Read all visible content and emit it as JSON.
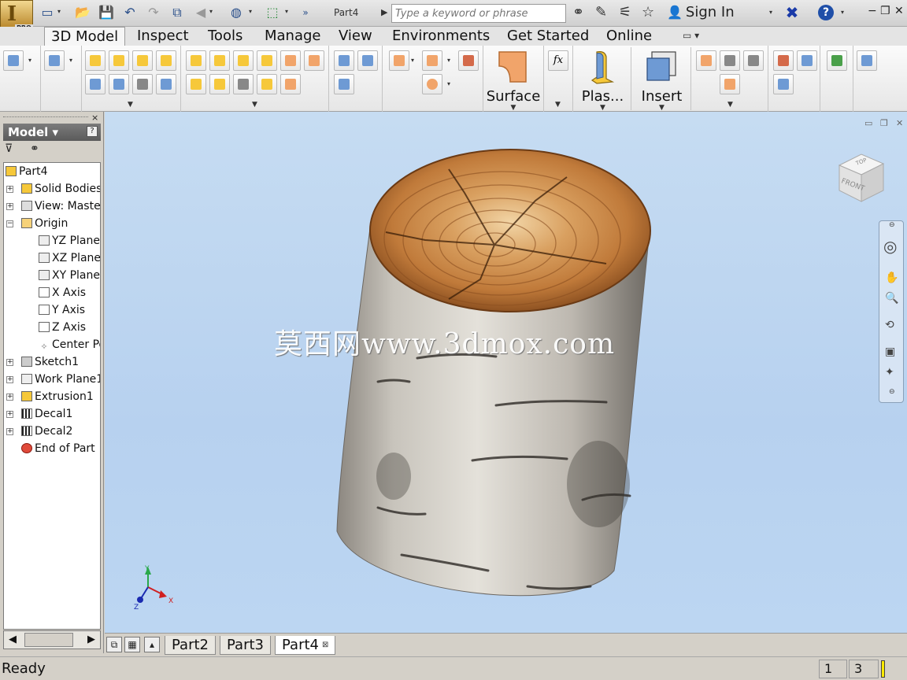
{
  "app": {
    "logo_letter": "I",
    "edition_badge": "PRO",
    "document_title": "Part4",
    "search_placeholder": "Type a keyword or phrase",
    "sign_in_label": "Sign In",
    "help_symbol": "?",
    "window_controls": [
      "−",
      "❐",
      "✕"
    ]
  },
  "quick_access": {
    "icons": [
      "new-icon",
      "open-icon",
      "save-icon",
      "undo-icon",
      "redo-icon",
      "update-icon",
      "back-icon",
      "appearance-icon",
      "select-icon",
      "overflow-icon"
    ]
  },
  "menu_tabs": [
    {
      "label": "3D Model",
      "active": true
    },
    {
      "label": "Inspect",
      "active": false
    },
    {
      "label": "Tools",
      "active": false
    },
    {
      "label": "Manage",
      "active": false
    },
    {
      "label": "View",
      "active": false
    },
    {
      "label": "Environments",
      "active": false
    },
    {
      "label": "Get Started",
      "active": false
    },
    {
      "label": "Online",
      "active": false
    }
  ],
  "ribbon": {
    "big_buttons": [
      {
        "label": "Surface"
      },
      {
        "label": "Plas..."
      },
      {
        "label": "Insert"
      }
    ],
    "fx_label": "fx",
    "accent_colors": {
      "sketch_orange": "#f1a46a",
      "feature_yellow": "#f6c83a",
      "feature_blue": "#6e9ad4"
    }
  },
  "browser": {
    "title": "Model ▾",
    "help_label": "?",
    "filter_icon": "funnel-icon",
    "find_icon": "binoculars-icon",
    "tree": [
      {
        "label": "Part4",
        "icon": "part-icon",
        "expander": ""
      },
      {
        "label": "Solid Bodies(",
        "icon": "solid-bodies-icon",
        "expander": "+"
      },
      {
        "label": "View: Maste",
        "icon": "view-rep-icon",
        "expander": "+"
      },
      {
        "label": "Origin",
        "icon": "folder-icon",
        "expander": "−"
      },
      {
        "label": "YZ Plane",
        "icon": "plane-icon",
        "expander": ""
      },
      {
        "label": "XZ Plane",
        "icon": "plane-icon",
        "expander": ""
      },
      {
        "label": "XY Plane",
        "icon": "plane-icon",
        "expander": ""
      },
      {
        "label": "X Axis",
        "icon": "axis-icon",
        "expander": ""
      },
      {
        "label": "Y Axis",
        "icon": "axis-icon",
        "expander": ""
      },
      {
        "label": "Z Axis",
        "icon": "axis-icon",
        "expander": ""
      },
      {
        "label": "Center Po",
        "icon": "point-icon",
        "expander": ""
      },
      {
        "label": "Sketch1",
        "icon": "sketch-icon",
        "expander": "+"
      },
      {
        "label": "Work Plane1",
        "icon": "plane-icon",
        "expander": "+"
      },
      {
        "label": "Extrusion1",
        "icon": "extrusion-icon",
        "expander": "+"
      },
      {
        "label": "Decal1",
        "icon": "decal-icon",
        "expander": "+"
      },
      {
        "label": "Decal2",
        "icon": "decal-icon",
        "expander": "+"
      },
      {
        "label": "End of Part",
        "icon": "end-of-part-icon",
        "expander": ""
      }
    ]
  },
  "viewport": {
    "watermark": "莫西网www.3dmox.com",
    "viewcube_top": "TOP",
    "viewcube_front": "FRONT",
    "triad": {
      "x": "X",
      "y": "Y",
      "z": "Z"
    },
    "colors": {
      "background": "#bcd6f2",
      "bark": "#b5b0a8",
      "wood": "#c98a4e"
    }
  },
  "document_tabs": [
    {
      "label": "Part2",
      "active": false
    },
    {
      "label": "Part3",
      "active": false
    },
    {
      "label": "Part4",
      "active": true,
      "close": "⊠"
    }
  ],
  "status": {
    "text": "Ready",
    "cell1": "1",
    "cell2": "3"
  }
}
